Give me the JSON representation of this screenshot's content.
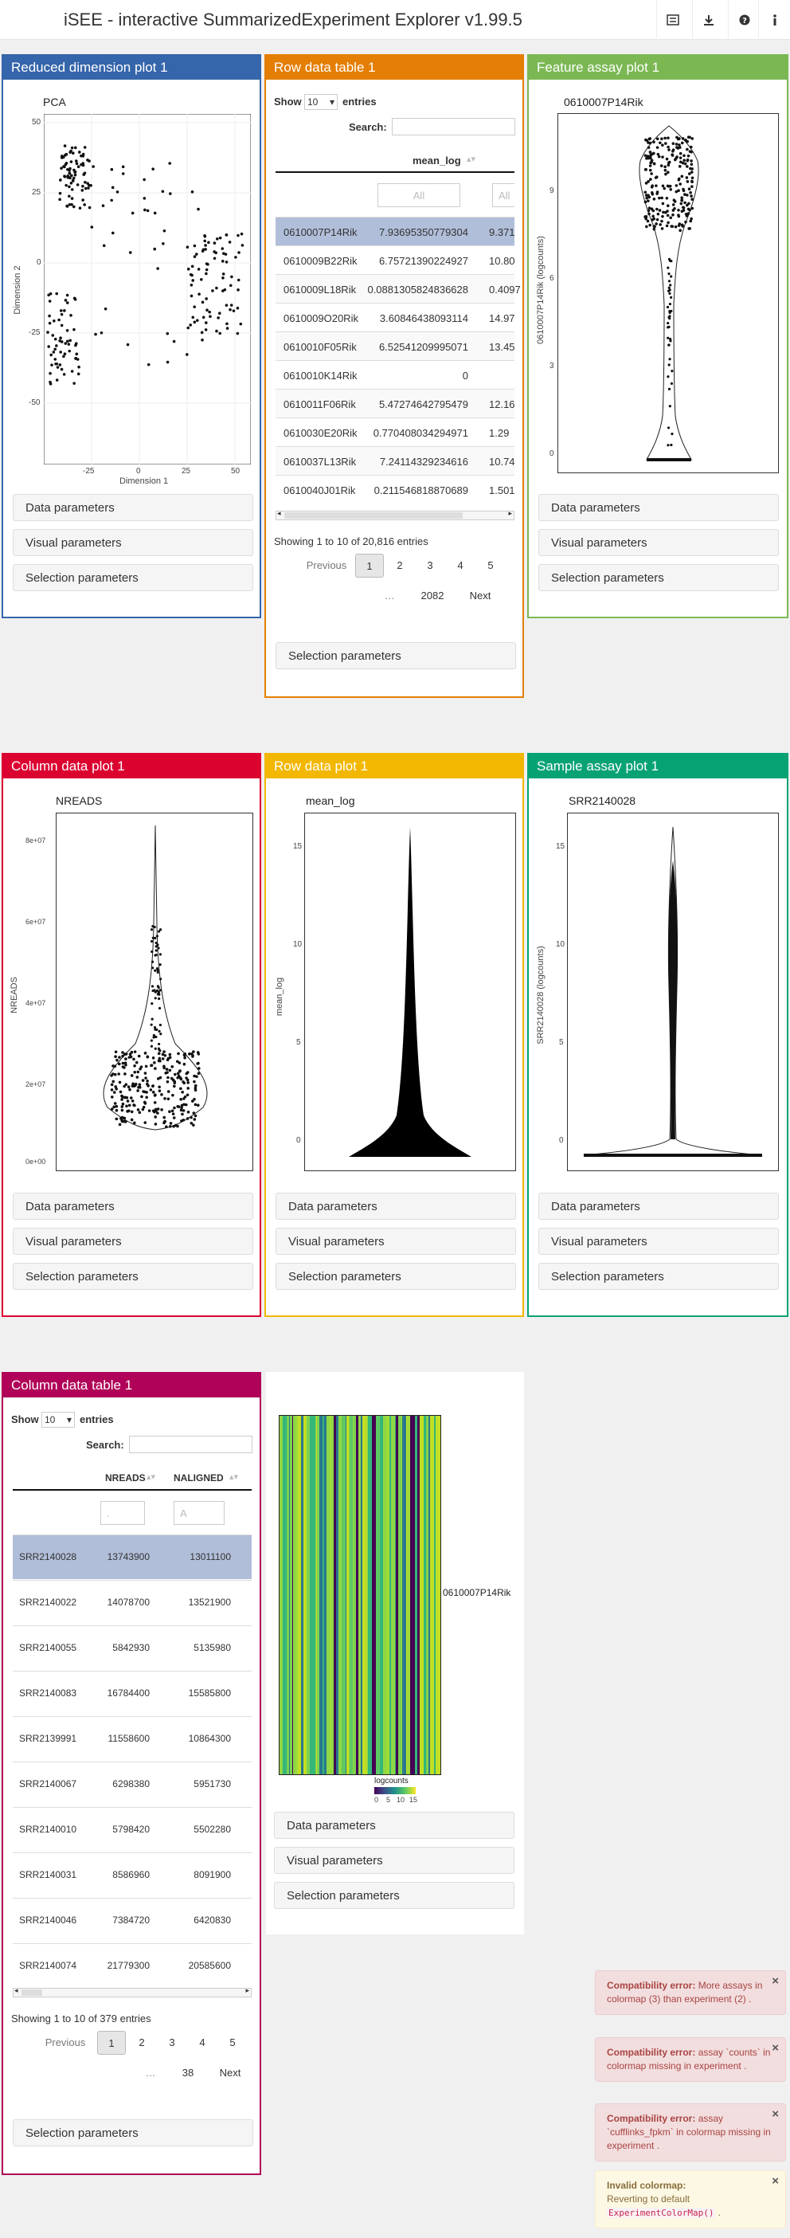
{
  "app": {
    "title": "iSEE - interactive SummarizedExperiment Explorer v1.99.5"
  },
  "colors": {
    "reduced_dim": "#3565AA",
    "row_table": "#E47E04",
    "feature_assay": "#7BB854",
    "column_data": "#DB0230",
    "row_data_plot": "#F2B701",
    "sample_assay": "#07A274",
    "column_table": "#B00258"
  },
  "toolbar": {
    "icons": [
      "tour-icon",
      "download-icon",
      "help-icon",
      "info-icon"
    ]
  },
  "common": {
    "data_params": "Data parameters",
    "visual_params": "Visual parameters",
    "selection_params": "Selection parameters",
    "show": "Show",
    "entries": "entries",
    "search": "Search:",
    "show_n": "10",
    "previous": "Previous",
    "next": "Next",
    "ellipsis": "…"
  },
  "panels": {
    "reduced_dim": {
      "title": "Reduced dimension plot 1",
      "plot_title": "PCA",
      "xlabel": "Dimension 1",
      "ylabel": "Dimension 2",
      "xticks": [
        "-25",
        "0",
        "25",
        "50"
      ],
      "yticks": [
        "50",
        "25",
        "0",
        "-25",
        "-50"
      ]
    },
    "row_table": {
      "title": "Row data table 1",
      "col": "mean_log",
      "filter_placeholder": "All",
      "rows": [
        [
          "0610007P14Rik",
          "7.93695350779304",
          "9.371"
        ],
        [
          "0610009B22Rik",
          "6.75721390224927",
          "10.80"
        ],
        [
          "0610009L18Rik",
          "0.0881305824836628",
          "0.4097"
        ],
        [
          "0610009O20Rik",
          "3.60846438093114",
          "14.97"
        ],
        [
          "0610010F05Rik",
          "6.52541209995071",
          "13.45"
        ],
        [
          "0610010K14Rik",
          "0",
          ""
        ],
        [
          "0610011F06Rik",
          "5.47274642795479",
          "12.16"
        ],
        [
          "0610030E20Rik",
          "0.770408034294971",
          "1.29"
        ],
        [
          "0610037L13Rik",
          "7.24114329234616",
          "10.74"
        ],
        [
          "0610040J01Rik",
          "0.211546818870689",
          "1.501"
        ]
      ],
      "info": "Showing 1 to 10 of 20,816 entries",
      "pages": [
        "1",
        "2",
        "3",
        "4",
        "5"
      ],
      "last_page": "2082"
    },
    "feature_assay": {
      "title": "Feature assay plot 1",
      "plot_title": "0610007P14Rik",
      "ylabel": "0610007P14Rik (logcounts)",
      "yticks": [
        "9",
        "6",
        "3",
        "0"
      ]
    },
    "column_data": {
      "title": "Column data plot 1",
      "plot_title": "NREADS",
      "ylabel": "NREADS",
      "yticks": [
        "8e+07",
        "6e+07",
        "4e+07",
        "2e+07",
        "0e+00"
      ]
    },
    "row_data_plot": {
      "title": "Row data plot 1",
      "plot_title": "mean_log",
      "ylabel": "mean_log",
      "yticks": [
        "15",
        "10",
        "5",
        "0"
      ]
    },
    "sample_assay": {
      "title": "Sample assay plot 1",
      "plot_title": "SRR2140028",
      "ylabel": "SRR2140028 (logcounts)",
      "yticks": [
        "15",
        "10",
        "5",
        "0"
      ]
    },
    "column_table": {
      "title": "Column data table 1",
      "col1": "NREADS",
      "col2": "NALIGNED",
      "filter1": ".",
      "filter2": "A",
      "rows": [
        [
          "SRR2140028",
          "13743900",
          "13011100"
        ],
        [
          "SRR2140022",
          "14078700",
          "13521900"
        ],
        [
          "SRR2140055",
          "5842930",
          "5135980"
        ],
        [
          "SRR2140083",
          "16784400",
          "15585800"
        ],
        [
          "SRR2139991",
          "11558600",
          "10864300"
        ],
        [
          "SRR2140067",
          "6298380",
          "5951730"
        ],
        [
          "SRR2140010",
          "5798420",
          "5502280"
        ],
        [
          "SRR2140031",
          "8586960",
          "8091900"
        ],
        [
          "SRR2140046",
          "7384720",
          "6420830"
        ],
        [
          "SRR2140074",
          "21779300",
          "20585600"
        ]
      ],
      "info": "Showing 1 to 10 of 379 entries",
      "pages": [
        "1",
        "2",
        "3",
        "4",
        "5"
      ],
      "last_page": "38"
    },
    "heatmap": {
      "gene_label": "0610007P14Rik",
      "legend_title": "logcounts",
      "legend_ticks": [
        "0",
        "5",
        "10",
        "15"
      ]
    }
  },
  "toasts": [
    {
      "bold": "Compatibility error:",
      "text": "More assays in colormap (3) than experiment (2) ."
    },
    {
      "bold": "Compatibility error:",
      "text": "assay `counts` in colormap missing in experiment ."
    },
    {
      "bold": "Compatibility error:",
      "text": "assay `cufflinks_fpkm` in colormap missing in experiment ."
    },
    {
      "bold": "Invalid colormap:",
      "text": "Reverting to default",
      "code": "ExperimentColorMap()",
      "tail": "."
    }
  ]
}
